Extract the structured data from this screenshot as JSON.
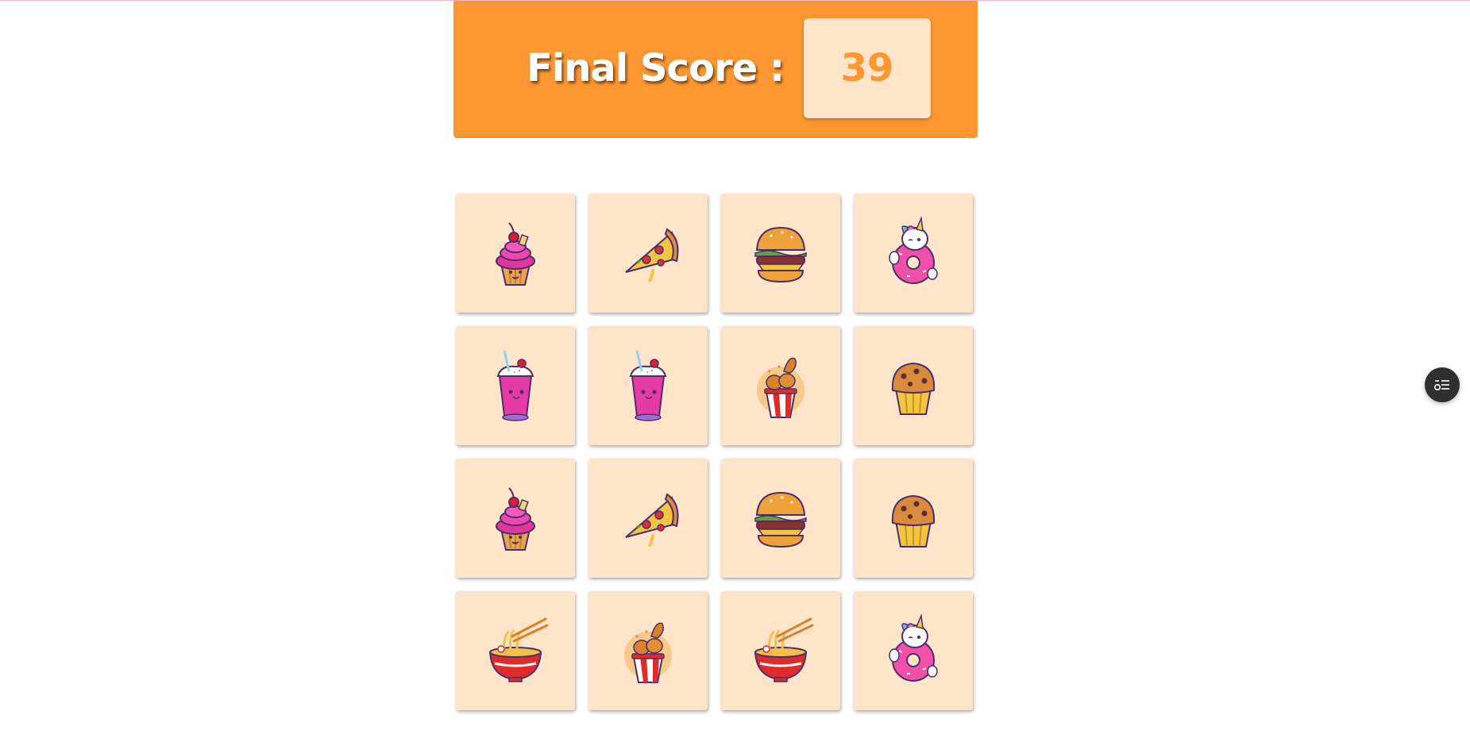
{
  "header": {
    "score_label": "Final Score :",
    "score_value": "39"
  },
  "cards": [
    {
      "icon": "cupcake-icon"
    },
    {
      "icon": "pizza-slice-icon"
    },
    {
      "icon": "burger-icon"
    },
    {
      "icon": "unicorn-donut-icon"
    },
    {
      "icon": "milkshake-icon"
    },
    {
      "icon": "milkshake-icon"
    },
    {
      "icon": "fried-chicken-bucket-icon"
    },
    {
      "icon": "muffin-icon"
    },
    {
      "icon": "cupcake-icon"
    },
    {
      "icon": "pizza-slice-icon"
    },
    {
      "icon": "burger-icon"
    },
    {
      "icon": "muffin-icon"
    },
    {
      "icon": "ramen-bowl-icon"
    },
    {
      "icon": "fried-chicken-bucket-icon"
    },
    {
      "icon": "ramen-bowl-icon"
    },
    {
      "icon": "unicorn-donut-icon"
    }
  ],
  "floating_button": {
    "icon": "toggle-list-icon"
  },
  "colors": {
    "accent": "#fd9731",
    "card": "#fee4c8"
  }
}
